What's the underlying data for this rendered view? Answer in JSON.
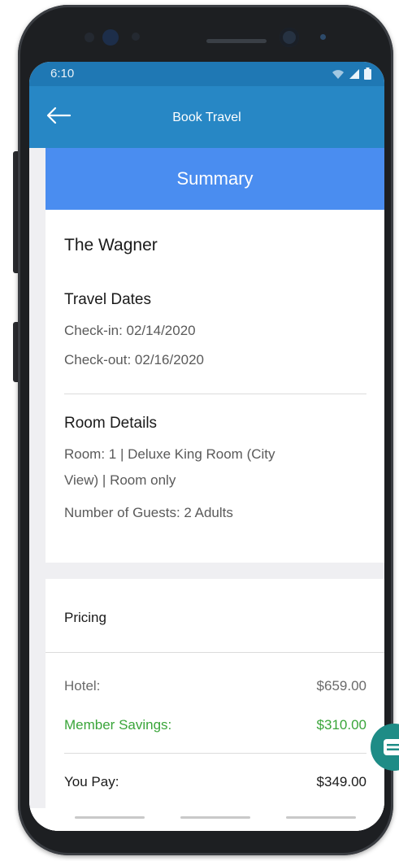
{
  "status_bar": {
    "time": "6:10"
  },
  "app_bar": {
    "title": "Book Travel"
  },
  "summary": {
    "header": "Summary",
    "hotel_name": "The Wagner",
    "travel_dates": {
      "title": "Travel Dates",
      "check_in": "Check-in: 02/14/2020",
      "check_out": "Check-out: 02/16/2020"
    },
    "room_details": {
      "title": "Room Details",
      "room_line1": "Room: 1 | Deluxe King Room (City",
      "room_line2": "View) | Room only",
      "guests": "Number of Guests: 2 Adults"
    }
  },
  "pricing": {
    "title": "Pricing",
    "hotel_label": "Hotel:",
    "hotel_value": "$659.00",
    "savings_label": "Member Savings:",
    "savings_value": "$310.00",
    "you_pay_label": "You Pay:",
    "you_pay_value": "$349.00"
  },
  "colors": {
    "status_bar": "#1f78b4",
    "app_bar": "#2787c5",
    "summary_header": "#4a8df0",
    "savings_green": "#3aa53a",
    "chat_fab": "#1e8c86"
  },
  "icons": {
    "back": "arrow-left-icon",
    "wifi": "wifi-icon",
    "signal": "signal-icon",
    "battery": "battery-icon",
    "chat": "chat-icon"
  }
}
